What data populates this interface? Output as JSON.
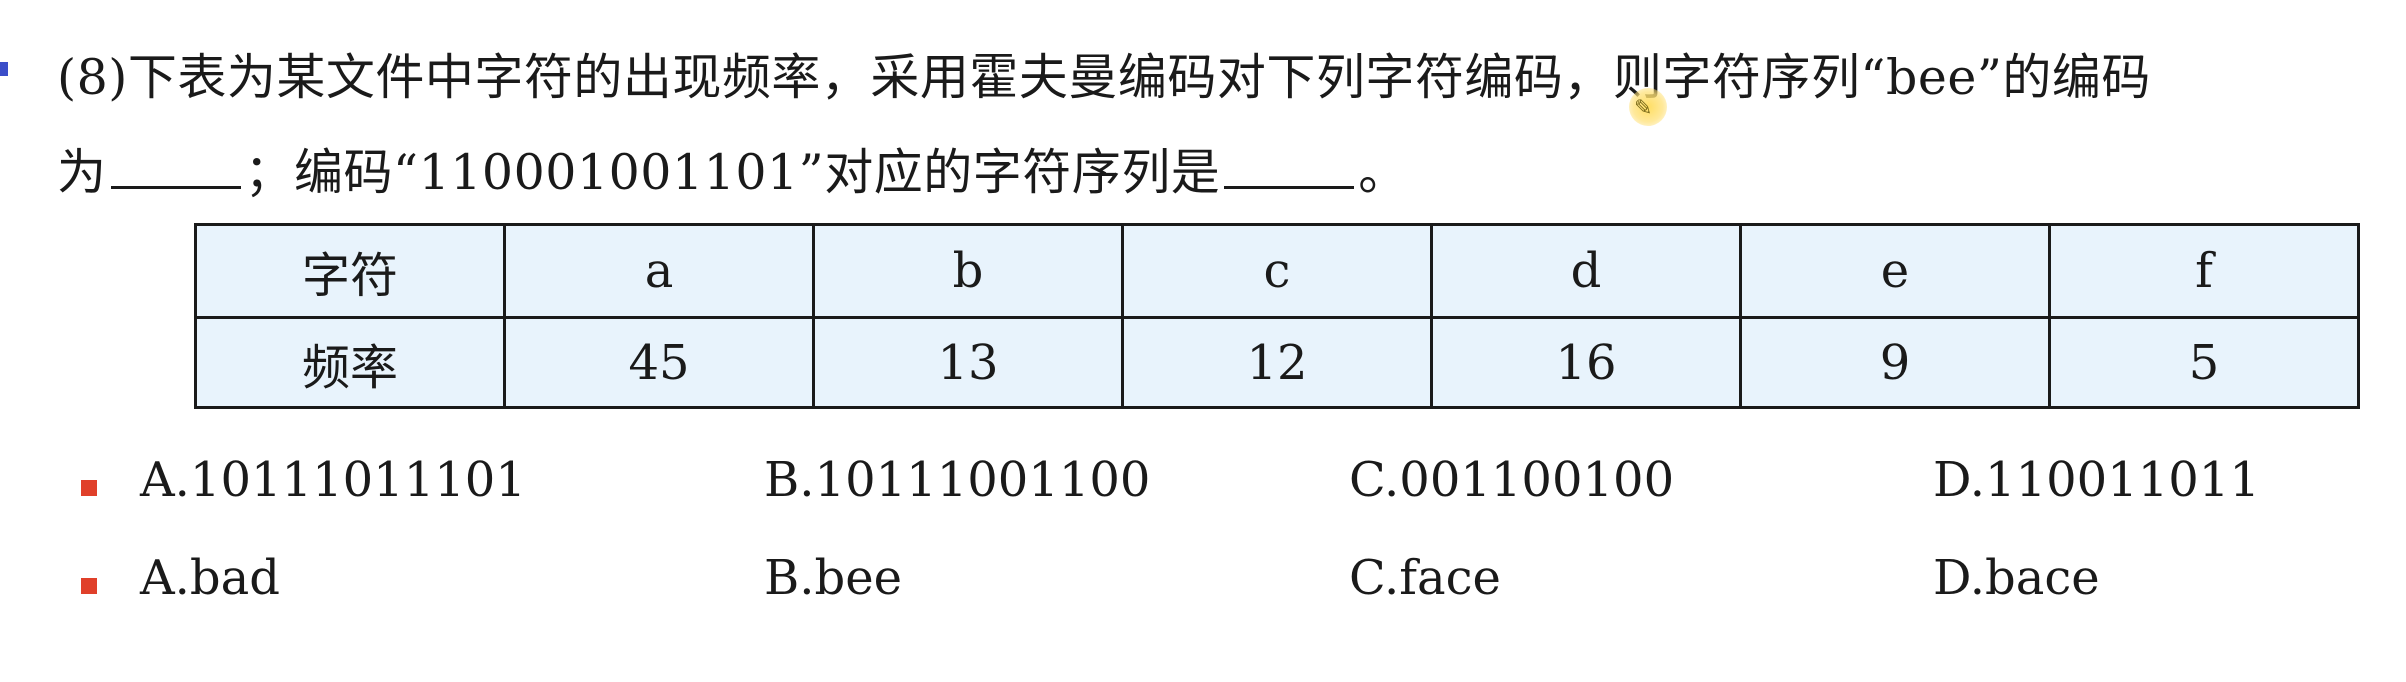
{
  "question": {
    "line1": "(8)下表为某文件中字符的出现频率，采用霍夫曼编码对下列字符编码，则字符序列“bee”的编码",
    "line2_part1": "为",
    "line2_part2": "；编码“110001001101”对应的字符序列是",
    "line2_part3": "。"
  },
  "table": {
    "header_label": "字符",
    "value_label": "频率",
    "characters": [
      "a",
      "b",
      "c",
      "d",
      "e",
      "f"
    ],
    "frequencies": [
      "45",
      "13",
      "12",
      "16",
      "9",
      "5"
    ]
  },
  "options": [
    {
      "a": "A.10111011101",
      "b": "B.10111001100",
      "c": "C.001100100",
      "d": "D.110011011"
    },
    {
      "a": "A.bad",
      "b": "B.bee",
      "c": "C.face",
      "d": "D.bace"
    }
  ],
  "colors": {
    "table_fill": "#e8f3fc",
    "bullet": "#e0402a",
    "marker": "#3b4ec9"
  }
}
